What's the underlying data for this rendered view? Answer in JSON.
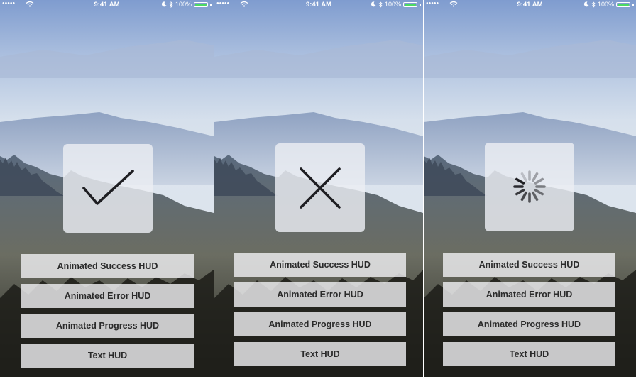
{
  "status_bar": {
    "signal": "●●●●●",
    "time": "9:41 AM",
    "battery": "100%"
  },
  "screens": [
    {
      "hud": "success",
      "buttons": [
        "Animated Success HUD",
        "Animated Error HUD",
        "Animated Progress HUD",
        "Text HUD"
      ]
    },
    {
      "hud": "error",
      "buttons": [
        "Animated Success HUD",
        "Animated Error HUD",
        "Animated Progress HUD",
        "Text HUD"
      ]
    },
    {
      "hud": "progress",
      "buttons": [
        "Animated Success HUD",
        "Animated Error HUD",
        "Animated Progress HUD",
        "Text HUD"
      ]
    }
  ],
  "colors": {
    "battery": "#4cd964",
    "hud_icon": "#1e1e22"
  }
}
